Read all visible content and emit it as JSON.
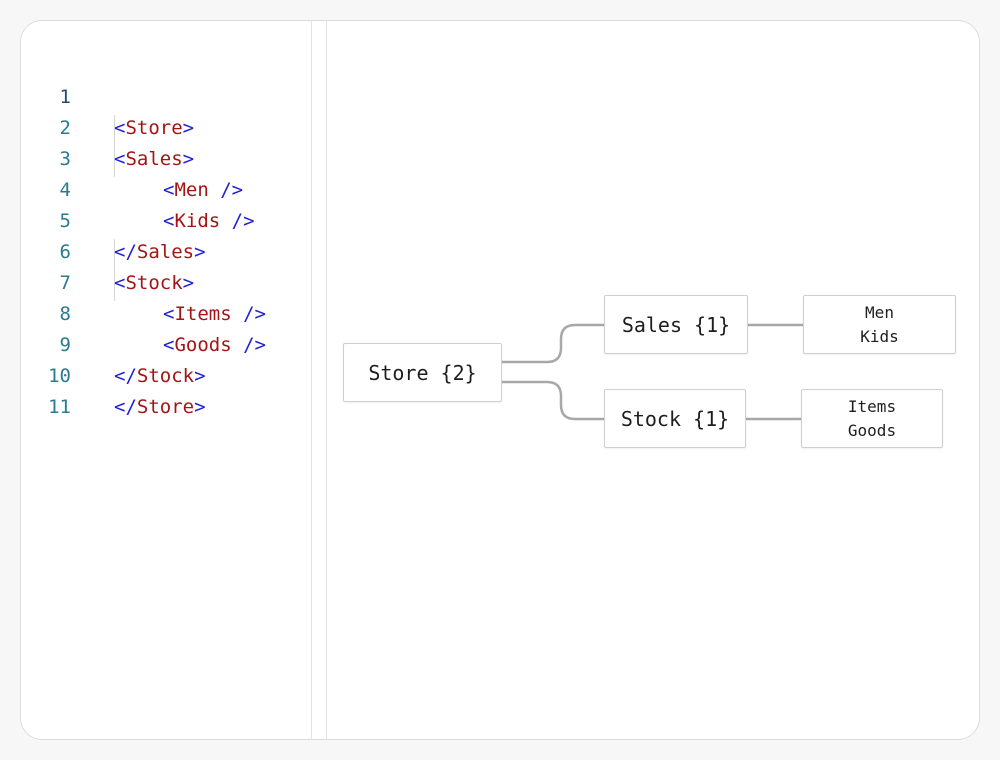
{
  "editor": {
    "lines": [
      {
        "n": "1",
        "open": "<",
        "tag": "Store",
        "close": ">"
      },
      {
        "n": "2",
        "open": "<",
        "tag": "Sales",
        "close": ">"
      },
      {
        "n": "3",
        "open": "<",
        "tag": "Men ",
        "close": "/>"
      },
      {
        "n": "4",
        "open": "<",
        "tag": "Kids ",
        "close": "/>"
      },
      {
        "n": "5",
        "open": "</",
        "tag": "Sales",
        "close": ">"
      },
      {
        "n": "6",
        "open": "<",
        "tag": "Stock",
        "close": ">"
      },
      {
        "n": "7",
        "open": "<",
        "tag": "Items ",
        "close": "/>"
      },
      {
        "n": "8",
        "open": "<",
        "tag": "Goods ",
        "close": "/>"
      },
      {
        "n": "9",
        "open": "</",
        "tag": "Stock",
        "close": ">"
      },
      {
        "n": "10",
        "open": "</",
        "tag": "Store",
        "close": ">"
      },
      {
        "n": "11",
        "open": "",
        "tag": "",
        "close": ""
      }
    ]
  },
  "tree": {
    "root": "Store {2}",
    "sales": "Sales {1}",
    "stock": "Stock {1}",
    "sales_children": [
      "Men",
      "Kids"
    ],
    "stock_children": [
      "Items",
      "Goods"
    ]
  }
}
